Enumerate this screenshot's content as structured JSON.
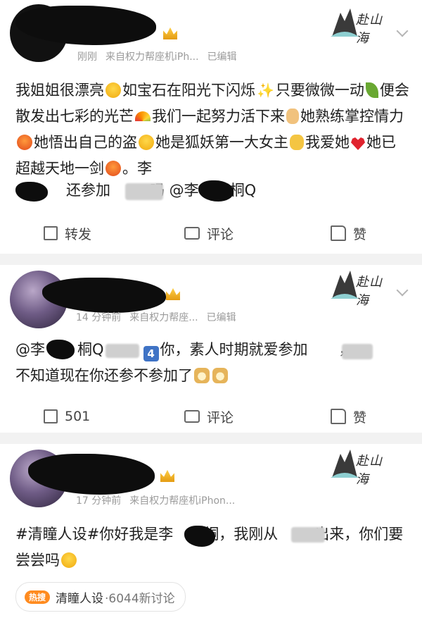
{
  "posts": [
    {
      "meta": {
        "time": "刚刚",
        "source": "来自权力帮座机iPh...",
        "edited": "已编辑"
      },
      "logo_text": "赴山海",
      "body": {
        "s1": "我姐姐很漂亮",
        "s2": "如宝石在阳光下闪烁",
        "s3": "只要微微一动",
        "s4": "便会散发出七彩的光芒",
        "s5": "我们一起努力活下来",
        "s6": "她熟练掌控情力",
        "s7": "她悟出自己的盗",
        "s8": "她是狐妖第一大女主",
        "s9": "我爱她",
        "s10": "她已超越天地一剑",
        "s11": "。李",
        "s12": "还参加",
        "s13": "吗 @李",
        "s14": "桐Q"
      },
      "actions": {
        "repost": "转发",
        "comment": "评论",
        "like": "赞"
      }
    },
    {
      "meta": {
        "time": "14 分钟前",
        "source": "来自权力帮座...",
        "edited": "已编辑"
      },
      "logo_text": "赴山海",
      "body": {
        "s1": "@李",
        "s2": "桐Q",
        "badge": "4",
        "s3": "你，素人时期就爱参加",
        "s4": "，",
        "s5": "不知道现在你还参不参加了"
      },
      "actions": {
        "repost": "501",
        "comment": "评论",
        "like": "赞"
      }
    },
    {
      "meta": {
        "time": "17 分钟前",
        "source": "来自权力帮座机iPhon..."
      },
      "logo_text": "赴山海",
      "body": {
        "s1": "#清瞳人设#你好我是李",
        "s2": "桐，我刚从",
        "s3": "出来，你们要尝尝吗"
      },
      "topic": {
        "hot_label": "热搜",
        "name": "清瞳人设",
        "count": "·6044新讨论"
      }
    }
  ],
  "colors": {
    "meta": "#9b9b9b",
    "text": "#1f1f1f",
    "hot": "#ff8b1f",
    "background": "#f2f2f2"
  }
}
